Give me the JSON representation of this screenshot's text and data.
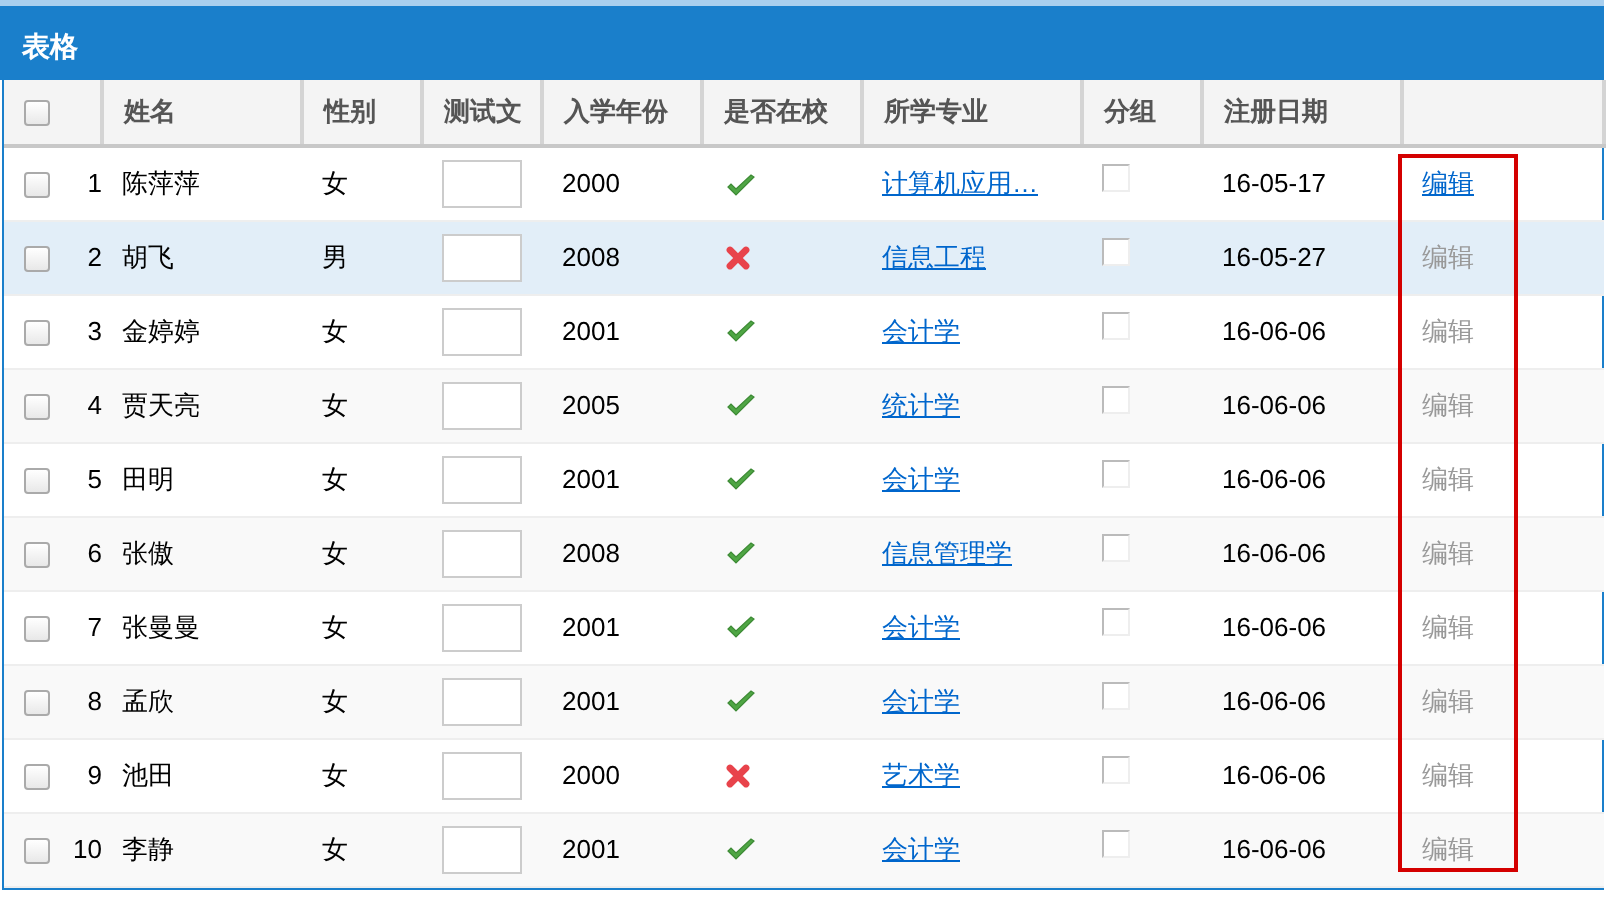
{
  "panel": {
    "title": "表格"
  },
  "columns": [
    {
      "kind": "check",
      "checked": false
    },
    {
      "kind": "blank"
    },
    {
      "kind": "text",
      "label": "姓名"
    },
    {
      "kind": "text",
      "label": "性别"
    },
    {
      "kind": "text",
      "label": "测试文"
    },
    {
      "kind": "text",
      "label": "入学年份"
    },
    {
      "kind": "text",
      "label": "是否在校"
    },
    {
      "kind": "text",
      "label": "所学专业"
    },
    {
      "kind": "text",
      "label": "分组"
    },
    {
      "kind": "text",
      "label": "注册日期"
    },
    {
      "kind": "blank"
    }
  ],
  "rows": [
    {
      "selected": false,
      "checked": false,
      "number": "1",
      "name": "陈萍萍",
      "gender": "女",
      "year": "2000",
      "enrolled": true,
      "major": "计算机应用…",
      "date": "16-05-17",
      "edit": "编辑",
      "edit_enabled": true
    },
    {
      "selected": true,
      "checked": false,
      "number": "2",
      "name": "胡飞",
      "gender": "男",
      "year": "2008",
      "enrolled": false,
      "major": "信息工程",
      "date": "16-05-27",
      "edit": "编辑",
      "edit_enabled": false
    },
    {
      "selected": false,
      "checked": false,
      "number": "3",
      "name": "金婷婷",
      "gender": "女",
      "year": "2001",
      "enrolled": true,
      "major": "会计学",
      "date": "16-06-06",
      "edit": "编辑",
      "edit_enabled": false
    },
    {
      "selected": false,
      "checked": false,
      "number": "4",
      "name": "贾天亮",
      "gender": "女",
      "year": "2005",
      "enrolled": true,
      "major": "统计学",
      "date": "16-06-06",
      "edit": "编辑",
      "edit_enabled": false
    },
    {
      "selected": false,
      "checked": false,
      "number": "5",
      "name": "田明",
      "gender": "女",
      "year": "2001",
      "enrolled": true,
      "major": "会计学",
      "date": "16-06-06",
      "edit": "编辑",
      "edit_enabled": false
    },
    {
      "selected": false,
      "checked": false,
      "number": "6",
      "name": "张傲",
      "gender": "女",
      "year": "2008",
      "enrolled": true,
      "major": "信息管理学",
      "date": "16-06-06",
      "edit": "编辑",
      "edit_enabled": false
    },
    {
      "selected": false,
      "checked": false,
      "number": "7",
      "name": "张曼曼",
      "gender": "女",
      "year": "2001",
      "enrolled": true,
      "major": "会计学",
      "date": "16-06-06",
      "edit": "编辑",
      "edit_enabled": false
    },
    {
      "selected": false,
      "checked": false,
      "number": "8",
      "name": "孟欣",
      "gender": "女",
      "year": "2001",
      "enrolled": true,
      "major": "会计学",
      "date": "16-06-06",
      "edit": "编辑",
      "edit_enabled": false
    },
    {
      "selected": false,
      "checked": false,
      "number": "9",
      "name": "池田",
      "gender": "女",
      "year": "2000",
      "enrolled": false,
      "major": "艺术学",
      "date": "16-06-06",
      "edit": "编辑",
      "edit_enabled": false
    },
    {
      "selected": false,
      "checked": false,
      "number": "10",
      "name": "李静",
      "gender": "女",
      "year": "2001",
      "enrolled": true,
      "major": "会计学",
      "date": "16-06-06",
      "edit": "编辑",
      "edit_enabled": false
    }
  ]
}
